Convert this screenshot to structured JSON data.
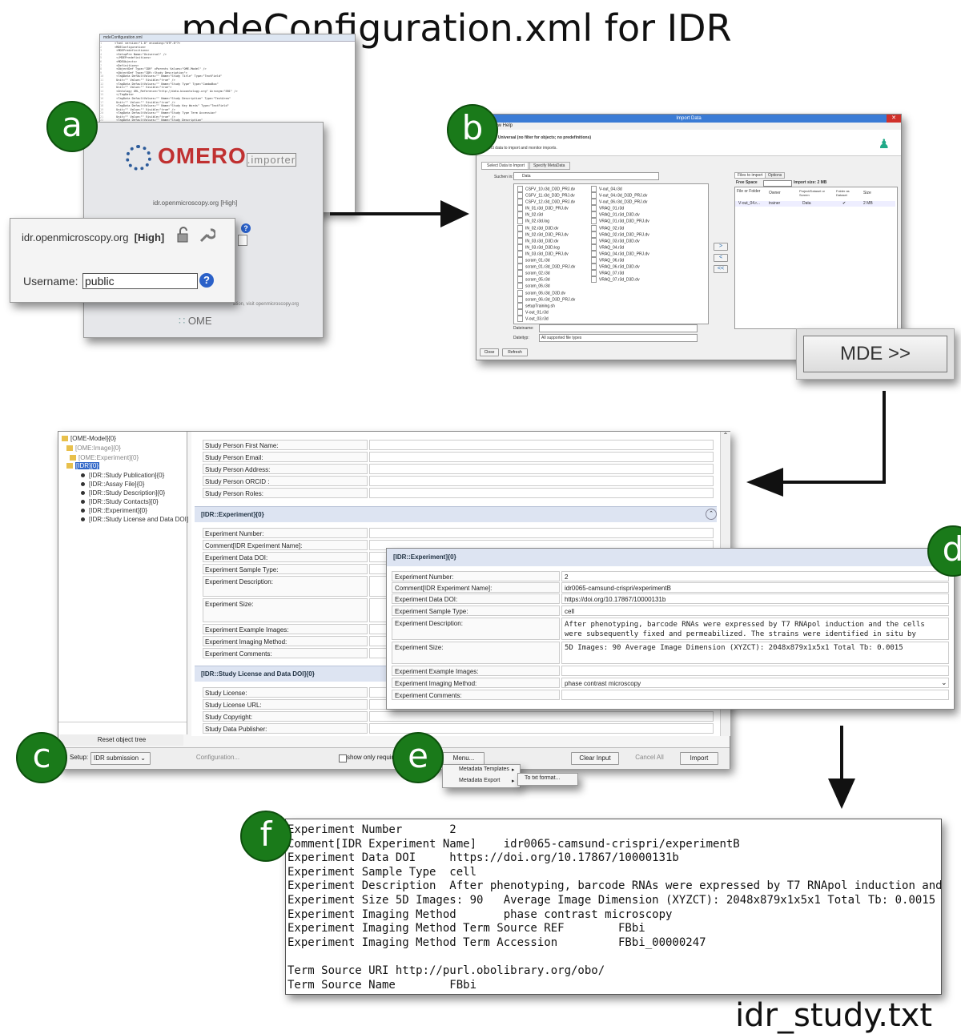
{
  "title": "mdeConfiguration.xml for IDR",
  "output_file_label": "idr_study.txt",
  "labels": [
    "a",
    "b",
    "c",
    "d",
    "e",
    "f"
  ],
  "colors": {
    "label_circle": "#1a7a1a",
    "import_title": "#3a7bd5",
    "section_header": "#dde4f2",
    "omero_red": "#c03030"
  },
  "xml_editor": {
    "tab": "mdeConfiguration.xml",
    "lines": [
      "<?xml version=\"1.0\" encoding=\"UTF-8\"?>",
      "<MDEConfiguration>",
      "  <MDEPredefinitions>",
      "    <SetupPre Name=\"Universal\" />",
      "  </MDEPredefinitions>",
      "  <MDEObjects>",
      "    <Definitions>",
      "      <ObjectDef Type=\"IDR\" xParents Values=\"OME-Model\" />",
      "      <ObjectDef Type=\"IDR::Study Description\">",
      "        <TagData DefaultValues=\"\" Name=\"Study Title\" Type=\"TextField\"",
      "          Unit=\"\" Value=\"\" Visible=\"true\" />",
      "        <TagData DefaultValues=\"\" Name=\"Study Type\" Type=\"ComboBox\"",
      "          Unit=\"\" Value=\"\" Visible=\"true\">",
      "          <Ontology URL_Reference=\"http://data.bioontology.org\" Acronym=\"EBI\" />",
      "        </TagData>",
      "        <TagData DefaultValues=\"\" Name=\"Study Description\" Type=\"TextArea\"",
      "          Unit=\"\" Value=\"\" Visible=\"true\" />",
      "        <TagData DefaultValues=\"\" Name=\"Study Key Words\" Type=\"TextField\"",
      "          Unit=\"\" Value=\"\" Visible=\"true\" />",
      "        <TagData DefaultValues=\"\" Name=\"Study Type Term Accession\"",
      "          Unit=\"\" Value=\"\" Visible=\"true\" />",
      "        <TagData DefaultValues=\"\" Name=\"Study Description\"",
      "          Unit=\"\" Value=\"\" Visible=\"true\" />"
    ]
  },
  "omero": {
    "logo": "OMERO",
    "logo_suffix": ".importer",
    "server_small": "idr.openmicroscopy.org  [High]",
    "footer": "OME",
    "footer_small": "ation, visit openmicroscopy.org"
  },
  "login": {
    "server": "idr.openmicroscopy.org",
    "security": "[High]",
    "username_label": "Username:",
    "username_value": "public",
    "help": "?"
  },
  "import_dialog": {
    "title": "Import Data",
    "menu": "dow   Help",
    "heading": "rt Data: Universal (no filter for objects; no predefinitions)",
    "subheading": "Select data to import and monitor imports.",
    "tabs": [
      "Select Data to Import",
      "Specify MetaData"
    ],
    "look_in_label": "Suchen in:",
    "look_in_value": "Data",
    "places": [
      "Zuletzt verw...",
      "Desktop",
      "Dokumente",
      "Dieser PC",
      "Netzwerk"
    ],
    "files_col1": [
      "CSFV_10.r3d_D3D_PRJ.dv",
      "CSFV_11.r3d_D3D_PRJ.dv",
      "CSFV_12.r3d_D3D_PRJ.dv",
      "IN_01.r3d_D3D_PRJ.dv",
      "IN_02.r3d",
      "IN_02.r3d.log",
      "IN_02.r3d_D3D.dv",
      "IN_02.r3d_D3D_PRJ.dv",
      "IN_03.r3d_D3D.dv",
      "IN_03.r3d_D3D.log",
      "IN_03.r3d_D3D_PRJ.dv",
      "scram_01.r3d",
      "scram_01.r3d_D3D_PRJ.dv",
      "scram_02.r3d",
      "scram_05.r3d",
      "scram_06.r3d",
      "scram_06.r3d_D3D.dv",
      "scram_06.r3d_D3D_PRJ.dv",
      "setupTraining.sh",
      "V-out_01.r3d",
      "V-out_03.r3d"
    ],
    "files_col2": [
      "V-out_04.r3d",
      "V-out_04.r3d_D3D_PRJ.dv",
      "V-out_06.r3d_D3D_PRJ.dv",
      "VRAQ_01.r3d",
      "VRAQ_01.r3d_D3D.dv",
      "VRAQ_01.r3d_D3D_PRJ.dv",
      "VRAQ_02.r3d",
      "VRAQ_02.r3d_D3D_PRJ.dv",
      "VRAQ_03.r3d_D3D.dv",
      "VRAQ_04.r3d",
      "VRAQ_04.r3d_D3D_PRJ.dv",
      "VRAQ_06.r3d",
      "VRAQ_06.r3d_D3D.dv",
      "VRAQ_07.r3d",
      "VRAQ_07.r3d_D3D.dv"
    ],
    "filename_label": "Dateiname:",
    "filetype_label": "Dateityp:",
    "filetype_value": "All supported file types",
    "right_tabs": [
      "Files to import",
      "Options"
    ],
    "free_space": "Free Space",
    "import_size": "Import size: 2 MB",
    "queue_headers": [
      "File or Folder",
      "Owner",
      "Project/Dataset or Screen",
      "Folder as Dataset",
      "Size"
    ],
    "queue_row": [
      "V-out_04.r...",
      "trainer",
      "Data",
      "✔",
      "2 MB"
    ],
    "buttons": [
      "Close",
      "Refresh"
    ],
    "arrows": [
      ">",
      "<",
      "<<"
    ]
  },
  "mde_button": "MDE >>",
  "mde": {
    "tree": [
      "[OME-Model]{0}",
      "[OME:Image]{0}",
      "[OME:Experiment]{0}",
      "[IDR]{0}",
      "[IDR::Study Publication]{0}",
      "[IDR::Assay File]{0}",
      "[IDR::Study Description]{0}",
      "[IDR::Study Contacts]{0}",
      "[IDR::Experiment]{0}",
      "[IDR::Study License and Data DOI]"
    ],
    "reset_tree": "Reset object tree",
    "contacts_fields": [
      "Study Person First Name:",
      "Study Person Email:",
      "Study Person Address:",
      "Study Person ORCID :",
      "Study Person Roles:"
    ],
    "experiment_header": "[IDR::Experiment]{0}",
    "experiment_fields": [
      "Experiment Number:",
      "Comment[IDR Experiment Name]:",
      "Experiment Data DOI:",
      "Experiment Sample Type:",
      "Experiment Description:",
      "Experiment Size:",
      "Experiment Example Images:",
      "Experiment Imaging Method:",
      "Experiment Comments:"
    ],
    "license_header": "[IDR::Study License and Data DOI]{0}",
    "license_fields": [
      "Study License:",
      "Study License URL:",
      "Study Copyright:",
      "Study Data Publisher:"
    ],
    "setup_label": "Setup:",
    "setup_value": "IDR submission",
    "configuration": "Configuration...",
    "show_only": "show only requir",
    "menu_button": "Menu...",
    "clear_input": "Clear Input",
    "cancel_all": "Cancel All",
    "import": "Import",
    "menu_items": [
      "Metadata Templates",
      "Metadata Export"
    ],
    "submenu_item": "To txt format..."
  },
  "detail_panel": {
    "header": "[IDR::Experiment]{0}",
    "rows": [
      {
        "label": "Experiment Number:",
        "value": "2"
      },
      {
        "label": "Comment[IDR Experiment Name]:",
        "value": "idr0065-camsund-crispri/experimentB"
      },
      {
        "label": "Experiment Data DOI:",
        "value": "https://doi.org/10.17867/10000131b"
      },
      {
        "label": "Experiment Sample Type:",
        "value": "cell"
      },
      {
        "label": "Experiment Description:",
        "value": "After phenotyping, barcode RNAs were expressed by T7 RNApol induction and the cells were subsequently fixed and permeabilized. The strains were identified in situ by"
      },
      {
        "label": "Experiment Size:",
        "value": "5D Images: 90   Average Image Dimension (XYZCT): 2048x879x1x5x1 Total Tb: 0.0015"
      },
      {
        "label": "Experiment Example Images:",
        "value": ""
      },
      {
        "label": "Experiment Imaging Method:",
        "value": "phase contrast microscopy"
      },
      {
        "label": "Experiment Comments:",
        "value": ""
      }
    ]
  },
  "text_file": {
    "lines": [
      "Experiment Number       2",
      "Comment[IDR Experiment Name]    idr0065-camsund-crispri/experimentB",
      "Experiment Data DOI     https://doi.org/10.17867/10000131b",
      "Experiment Sample Type  cell",
      "Experiment Description  After phenotyping, barcode RNAs were expressed by T7 RNApol induction and the ce",
      "Experiment Size 5D Images: 90   Average Image Dimension (XYZCT): 2048x879x1x5x1 Total Tb: 0.0015",
      "Experiment Imaging Method       phase contrast microscopy",
      "Experiment Imaging Method Term Source REF        FBbi",
      "Experiment Imaging Method Term Accession         FBbi_00000247",
      "",
      "Term Source URI http://purl.obolibrary.org/obo/",
      "Term Source Name        FBbi"
    ]
  }
}
